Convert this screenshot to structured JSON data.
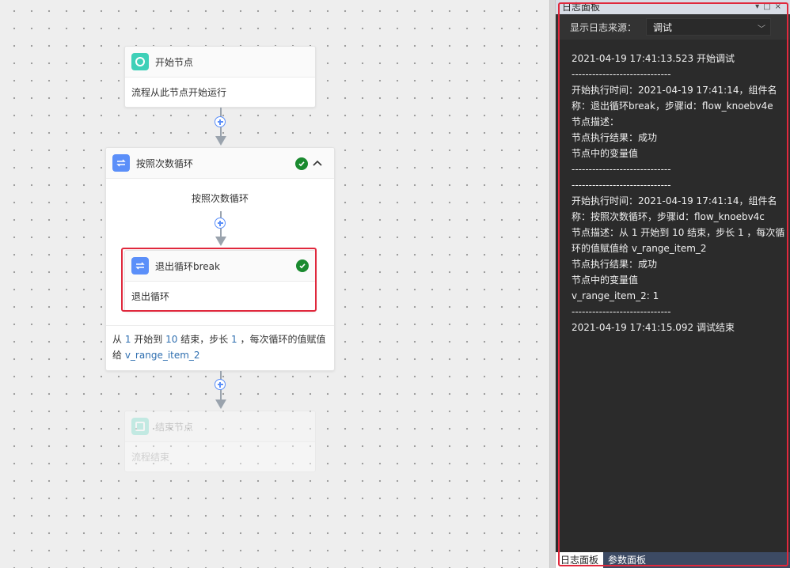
{
  "canvas": {
    "start_node": {
      "title": "开始节点",
      "desc": "流程从此节点开始运行"
    },
    "loop_node": {
      "title": "按照次数循环",
      "inner_title": "按照次数循环",
      "desc_parts": [
        "从 ",
        "1",
        " 开始到 ",
        "10",
        " 结束，步长 ",
        "1",
        " ，每次循环的值赋值给 ",
        "v_range_item_2"
      ]
    },
    "break_node": {
      "title": "退出循环break",
      "desc": "退出循环"
    },
    "end_node": {
      "title": "结束节点",
      "desc": "流程结束"
    }
  },
  "log_panel": {
    "title": "日志面板",
    "source_label": "显示日志来源：",
    "source_value": "调试",
    "log_lines": [
      "2021-04-19 17:41:13.523 开始调试",
      "-----------------------------",
      "开始执行时间：2021-04-19 17:41:14，组件名称：退出循环break，步骤id：flow_knoebv4e",
      "节点描述：",
      "节点执行结果：成功",
      "节点中的变量值",
      "-----------------------------",
      "-----------------------------",
      "开始执行时间：2021-04-19 17:41:14，组件名称：按照次数循环，步骤id：flow_knoebv4c",
      "节点描述：从 1 开始到 10 结束，步长 1 ，每次循环的值赋值给 v_range_item_2",
      "节点执行结果：成功",
      "节点中的变量值",
      "v_range_item_2: 1",
      "-----------------------------",
      "2021-04-19 17:41:15.092 调试结束"
    ],
    "tabs": [
      "日志面板",
      "参数面板"
    ]
  },
  "colors": {
    "accent": "#5b8ff9",
    "start_icon": "#3ed0b8",
    "success": "#1a8a2f",
    "highlight": "#e0283c",
    "log_bg": "#2b2b2b"
  }
}
